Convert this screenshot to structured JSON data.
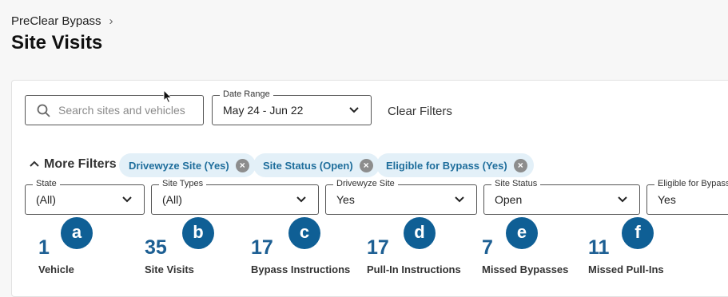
{
  "breadcrumb": {
    "parent": "PreClear Bypass"
  },
  "page": {
    "title": "Site Visits"
  },
  "search": {
    "placeholder": "Search sites and vehicles"
  },
  "date_range": {
    "label": "Date Range",
    "value": "May 24 - Jun 22"
  },
  "clear_filters": "Clear Filters",
  "more_filters": "More Filters",
  "chips": [
    {
      "label": "Drivewyze Site (Yes)"
    },
    {
      "label": "Site Status (Open)"
    },
    {
      "label": "Eligible for Bypass (Yes)"
    }
  ],
  "filters": [
    {
      "label": "State",
      "value": "(All)"
    },
    {
      "label": "Site Types",
      "value": "(All)"
    },
    {
      "label": "Drivewyze Site",
      "value": "Yes"
    },
    {
      "label": "Site Status",
      "value": "Open"
    },
    {
      "label": "Eligible for Bypass",
      "value": "Yes"
    }
  ],
  "stats": [
    {
      "value": "1",
      "label": "Vehicle",
      "badge": "a"
    },
    {
      "value": "35",
      "label": "Site Visits",
      "badge": "b"
    },
    {
      "value": "17",
      "label": "Bypass Instructions",
      "badge": "c"
    },
    {
      "value": "17",
      "label": "Pull-In Instructions",
      "badge": "d"
    },
    {
      "value": "7",
      "label": "Missed Bypasses",
      "badge": "e"
    },
    {
      "value": "11",
      "label": "Missed Pull-Ins",
      "badge": "f"
    }
  ],
  "colors": {
    "accent": "#1d5f93",
    "badge": "#0f5f95",
    "chip_bg": "#e3f0f8",
    "chip_text": "#1f6e9c"
  },
  "icons": {
    "search": "search-icon",
    "dropdown": "chevron-down-icon",
    "chip_remove": "close-icon",
    "breadcrumb_sep": "chevron-right-icon",
    "collapse": "chevron-up-icon",
    "cursor": "mouse-cursor-icon"
  }
}
